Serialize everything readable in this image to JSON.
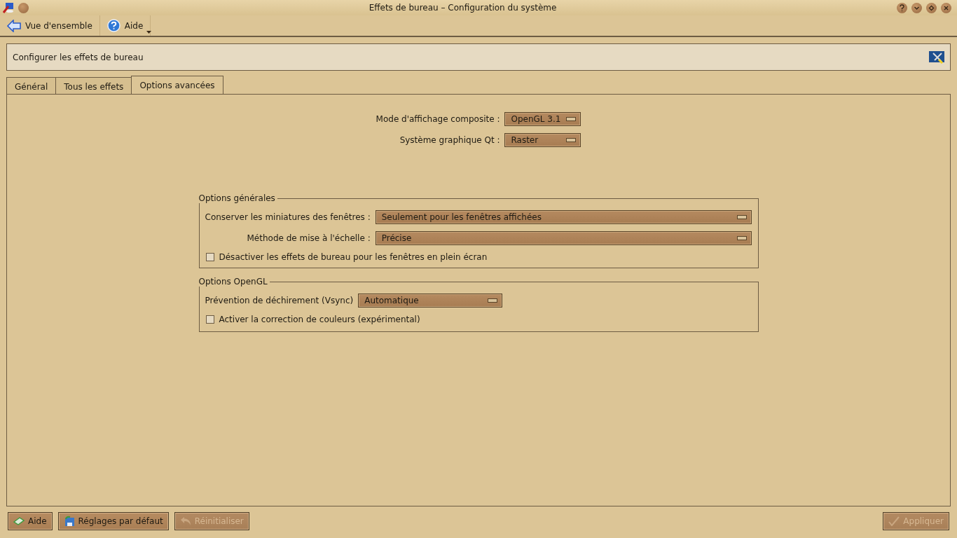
{
  "window": {
    "title": "Effets de bureau – Configuration du système"
  },
  "toolbar": [
    {
      "label": "Vue d'ensemble",
      "kind": "back",
      "dropdown": false
    },
    {
      "label": "Aide",
      "kind": "help",
      "dropdown": true
    }
  ],
  "header": {
    "title": "Configurer les effets de bureau"
  },
  "tabs": [
    {
      "label": "Général",
      "selected": false
    },
    {
      "label": "Tous les effets",
      "selected": false
    },
    {
      "label": "Options avancées",
      "selected": true
    }
  ],
  "top_settings": [
    {
      "label": "Mode d'affichage composite :",
      "value": "OpenGL 3.1"
    },
    {
      "label": "Système graphique Qt :",
      "value": "Raster"
    }
  ],
  "groups": [
    {
      "title": "Options générales",
      "rows": [
        {
          "kind": "combo",
          "label": "Conserver les miniatures des fenêtres :",
          "value": "Seulement pour les fenêtres affichées"
        },
        {
          "kind": "combo",
          "label": "Méthode de mise à l'échelle :",
          "value": "Précise"
        },
        {
          "kind": "checkbox",
          "label": "Désactiver les effets de bureau pour les fenêtres en plein écran",
          "checked": false
        }
      ]
    },
    {
      "title": "Options OpenGL",
      "rows": [
        {
          "kind": "combo_short",
          "label": "Prévention de déchirement (Vsync)",
          "value": "Automatique"
        },
        {
          "kind": "checkbox",
          "label": "Activer la correction de couleurs (expérimental)",
          "checked": false
        }
      ]
    }
  ],
  "buttons": [
    {
      "label": "Aide",
      "kind": "help",
      "disabled": false
    },
    {
      "label": "Réglages par défaut",
      "kind": "defaults",
      "disabled": false
    },
    {
      "label": "Réinitialiser",
      "kind": "reset",
      "disabled": true
    }
  ],
  "apply_button": {
    "label": "Appliquer",
    "disabled": true
  }
}
